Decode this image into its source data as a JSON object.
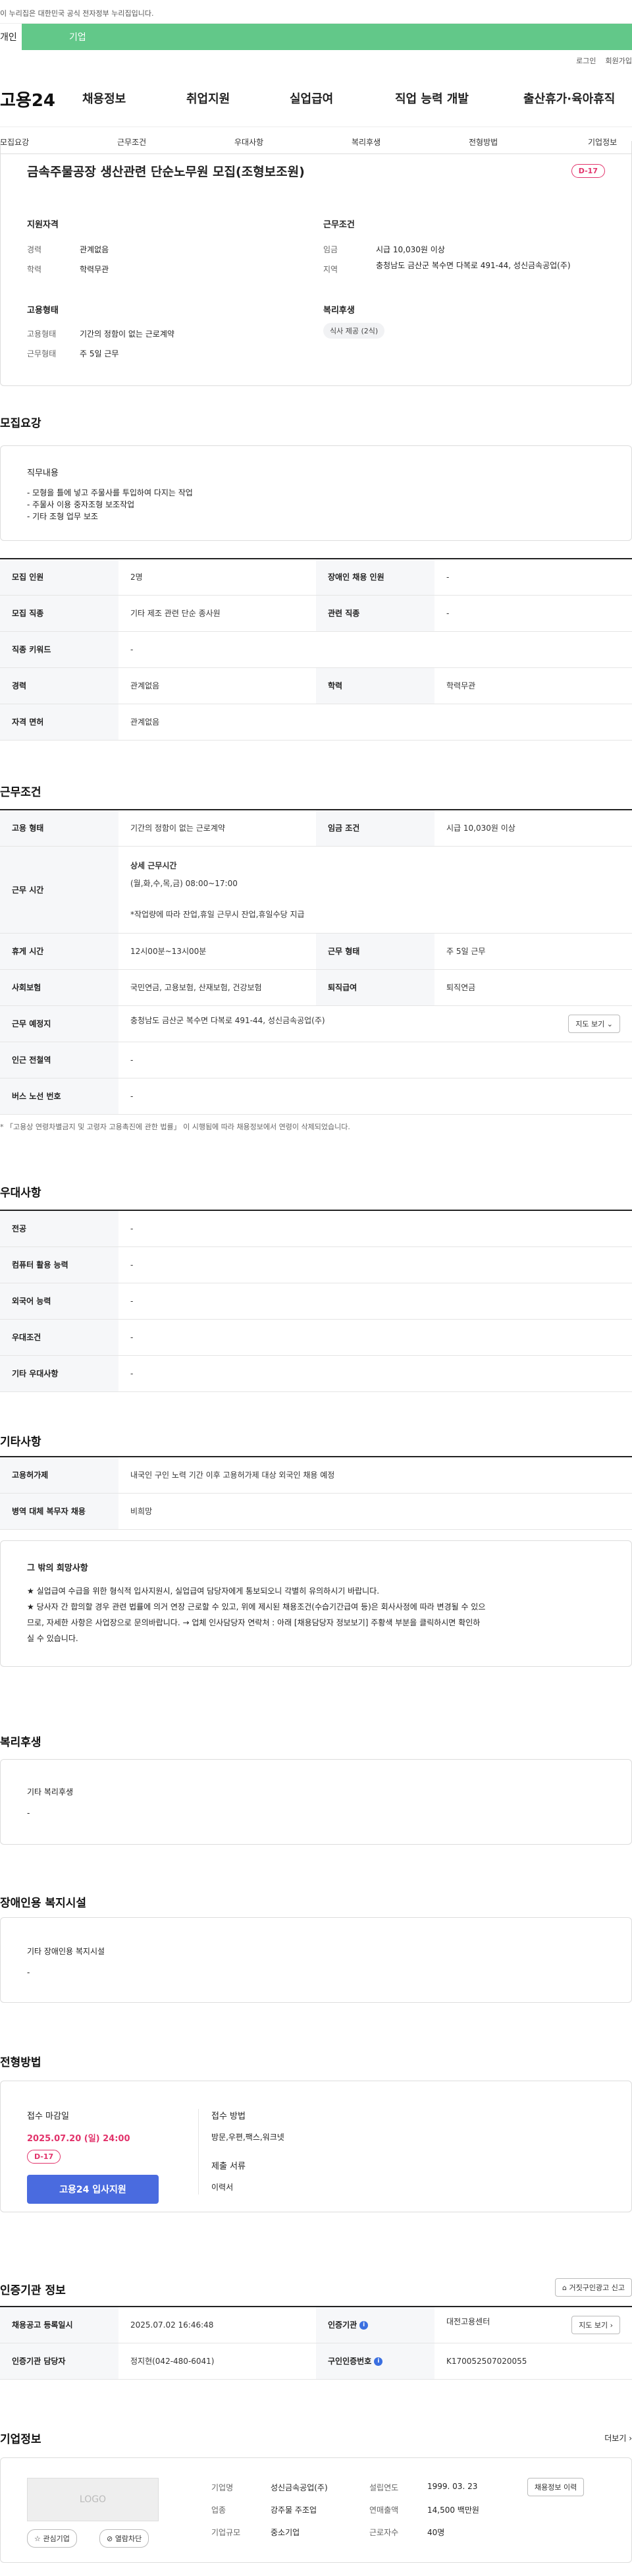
{
  "gov_banner": "이 누리집은 대한민국 공식 전자정부 누리집입니다.",
  "user_tabs": {
    "personal": "개인",
    "company": "기업"
  },
  "top_links": [
    "로그인",
    "회원가입"
  ],
  "logo": "고용24",
  "main_nav": [
    "채용정보",
    "취업지원",
    "실업급여",
    "직업 능력 개발",
    "출산휴가·육아휴직"
  ],
  "anchor_nav": [
    "모집요강",
    "근무조건",
    "우대사항",
    "복리후생",
    "전형방법",
    "기업정보"
  ],
  "summary": {
    "title": "금속주물공장 생산관련 단순노무원 모집(조형보조원)",
    "dday": "D-17",
    "qual_title": "지원자격",
    "career_label": "경력",
    "career": "관계없음",
    "edu_label": "학력",
    "edu": "학력무관",
    "emp_title": "고용형태",
    "emptype_label": "고용형태",
    "emptype": "기간의 정함이 없는 근로계약",
    "worktype_label": "근무형태",
    "worktype": "주 5일 근무",
    "cond_title": "근무조건",
    "wage_label": "임금",
    "wage": "시급 10,030원 이상",
    "region_label": "지역",
    "region": "충청남도 금산군 복수면 다복로 491-44, 성신금속공업(주)",
    "welfare_title": "복리후생",
    "welfare_chip": "식사 제공 (2식)"
  },
  "recruit": {
    "title": "모집요강",
    "duty_title": "직무내용",
    "duties": [
      "- 모형을 틀에 넣고 주물사를 투입하여 다지는 작업",
      "- 주물사 이용 중자조형 보조작업",
      "- 기타 조형 업무 보조"
    ],
    "rows": [
      {
        "k1": "모집 인원",
        "v1": "2명",
        "k2": "장애인 채용 인원",
        "v2": "-"
      },
      {
        "k1": "모집 직종",
        "v1": "기타 제조 관련 단순 종사원",
        "k2": "관련 직종",
        "v2": "-"
      },
      {
        "k1": "직종 키워드",
        "v1": "-",
        "k2": "",
        "v2": ""
      },
      {
        "k1": "경력",
        "v1": "관계없음",
        "k2": "학력",
        "v2": "학력무관"
      },
      {
        "k1": "자격 면허",
        "v1": "관계없음",
        "k2": "",
        "v2": ""
      }
    ]
  },
  "work": {
    "title": "근무조건",
    "emp_k": "고용 형태",
    "emp_v": "기간의 정함이 없는 근로계약",
    "wage_k": "임금 조건",
    "wage_v": "시급 10,030원 이상",
    "time_k": "근무 시간",
    "time_head": "상세 근무시간",
    "time_days": "(월,화,수,목,금) 08:00~17:00",
    "time_note": "*작업량에 따라 잔업,휴일 근무시 잔업,휴일수당 지급",
    "rest_k": "휴게 시간",
    "rest_v": "12시00분~13시00분",
    "form_k": "근무 형태",
    "form_v": "주 5일 근무",
    "ins_k": "사회보험",
    "ins_v": "국민연금, 고용보험, 산재보험, 건강보험",
    "ret_k": "퇴직급여",
    "ret_v": "퇴직연금",
    "place_k": "근무 예정지",
    "place_v": "충청남도 금산군 복수면 다복로 491-44, 성신금속공업(주)",
    "map_btn": "지도 보기",
    "subway_k": "인근 전철역",
    "subway_v": "-",
    "bus_k": "버스 노선 번호",
    "bus_v": "-",
    "law_note": "* 「고용상 연령차별금지 및 고령자 고용촉진에 관한 법률」 이 시행됨에 따라 채용정보에서 연령이 삭제되었습니다."
  },
  "pref": {
    "title": "우대사항",
    "rows": [
      {
        "k": "전공",
        "v": "-"
      },
      {
        "k": "컴퓨터 활용 능력",
        "v": "-"
      },
      {
        "k": "외국어 능력",
        "v": "-"
      },
      {
        "k": "우대조건",
        "v": "-"
      },
      {
        "k": "기타 우대사항",
        "v": "-"
      }
    ]
  },
  "etc": {
    "title": "기타사항",
    "rows": [
      {
        "k": "고용허가제",
        "v": "내국인 구인 노력 기간 이후 고용허가제 대상 외국인 채용 예정"
      },
      {
        "k": "병역 대체 복무자 채용",
        "v": "비희망"
      }
    ],
    "box_title": "그 밖의 희망사항",
    "box_lines": [
      "★ 실업급여 수급을 위한 형식적 입사지원시, 실업급여 담당자에게 통보되오니 각별히 유의하시기 바랍니다.",
      "★ 당사자 간 합의할 경우 관련 법률에 의거 연장 근로할 수 있고, 위에 제시된 채용조건(수습기간급여 등)은 회사사정에 따라 변경될 수 있으",
      "므로, 자세한 사항은 사업장으로 문의바랍니다. → 업체 인사담당자 연락처 : 아래 [채용담당자 정보보기] 주황색 부분을 클릭하시면 확인하",
      "실 수 있습니다."
    ]
  },
  "welfare": {
    "title": "복리후생",
    "box_title": "기타 복리후생",
    "box_value": "-"
  },
  "disabled": {
    "title": "장애인용 복지시설",
    "box_title": "기타 장애인용 복지시설",
    "box_value": "-"
  },
  "process": {
    "title": "전형방법",
    "deadline_title": "접수 마감일",
    "deadline": "2025.07.20 (일) 24:00",
    "dday": "D-17",
    "apply_btn": "고용24 입사지원",
    "method_title": "접수 방법",
    "method": "방문,우편,팩스,워크넷",
    "docs_title": "제출 서류",
    "docs": "이력서"
  },
  "agency": {
    "title": "인증기관 정보",
    "report_btn": "거짓구인광고 신고",
    "reg_k": "채용공고 등록일시",
    "reg_v": "2025.07.02 16:46:48",
    "org_k": "인증기관",
    "org_v": "대전고용센터",
    "map_btn": "지도 보기",
    "staff_k": "인증기관 담당자",
    "staff_v": "정지현(042-480-6041)",
    "no_k": "구인인증번호",
    "no_v": "K170052507020055"
  },
  "company": {
    "title": "기업정보",
    "more": "더보기",
    "logo_text": "LOGO",
    "fav_btn": "관심기업",
    "block_btn": "열람차단",
    "name_k": "기업명",
    "name_v": "성신금속공업(주)",
    "est_k": "설립연도",
    "est_v": "1999. 03. 23",
    "jobs_btn": "채용정보 이력",
    "ind_k": "업종",
    "ind_v": "강주물 주조업",
    "sales_k": "연매출액",
    "sales_v": "14,500 백만원",
    "size_k": "기업규모",
    "size_v": "중소기업",
    "emp_k": "근로자수",
    "emp_v": "40명"
  }
}
